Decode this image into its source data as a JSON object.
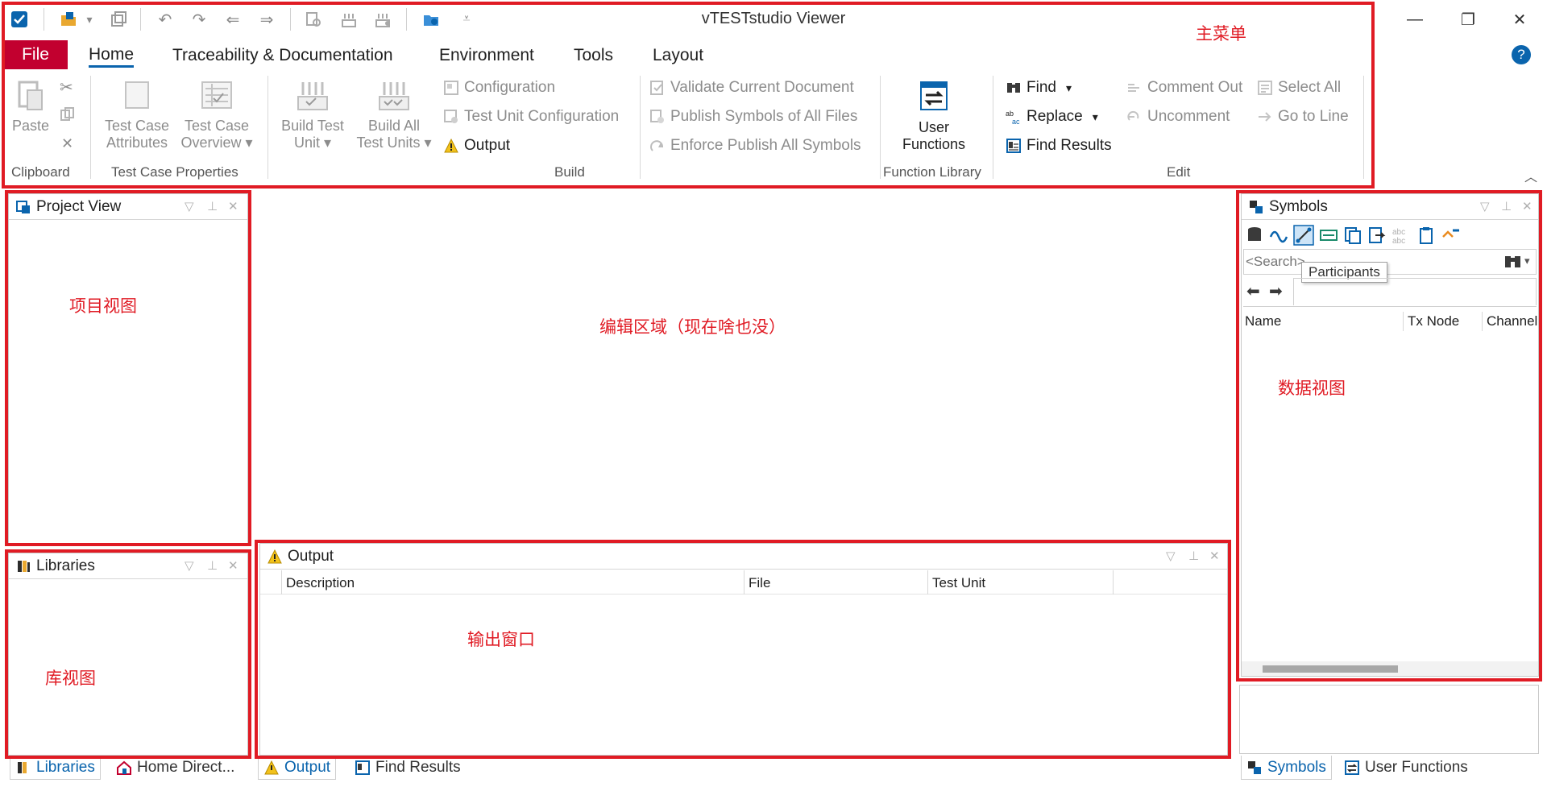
{
  "window": {
    "title": "vTESTstudio Viewer"
  },
  "menu": {
    "tabs": [
      "File",
      "Home",
      "Traceability & Documentation",
      "Environment",
      "Tools",
      "Layout"
    ]
  },
  "ribbon": {
    "clipboard": {
      "label": "Clipboard",
      "paste": "Paste"
    },
    "test_case_properties": {
      "label": "Test Case Properties",
      "attributes_line1": "Test Case",
      "attributes_line2": "Attributes",
      "overview_line1": "Test Case",
      "overview_line2": "Overview"
    },
    "build": {
      "label": "Build",
      "build_unit_line1": "Build Test",
      "build_unit_line2": "Unit",
      "build_all_line1": "Build All",
      "build_all_line2": "Test Units",
      "configuration": "Configuration",
      "test_unit_configuration": "Test Unit Configuration",
      "output": "Output",
      "validate": "Validate Current Document",
      "publish": "Publish Symbols of All Files",
      "enforce": "Enforce Publish All Symbols"
    },
    "function_library": {
      "label": "Function Library",
      "user_functions_line1": "User",
      "user_functions_line2": "Functions"
    },
    "edit": {
      "label": "Edit",
      "find": "Find",
      "replace": "Replace",
      "find_results": "Find Results",
      "comment_out": "Comment Out",
      "uncomment": "Uncomment",
      "select_all": "Select All",
      "go_to_line": "Go to Line"
    }
  },
  "panels": {
    "project_view": {
      "title": "Project View"
    },
    "libraries": {
      "title": "Libraries"
    },
    "output": {
      "title": "Output",
      "columns": [
        "Description",
        "File",
        "Test Unit"
      ]
    },
    "symbols": {
      "title": "Symbols",
      "search_placeholder": "<Search>",
      "tooltip": "Participants",
      "columns": [
        "Name",
        "Tx Node",
        "Channel"
      ]
    }
  },
  "bottom_tabs": {
    "left": [
      "Libraries",
      "Home Direct..."
    ],
    "center": [
      "Output",
      "Find Results"
    ],
    "right": [
      "Symbols",
      "User Functions"
    ]
  },
  "annotations": {
    "main_menu": "主菜单",
    "project_view": "项目视图",
    "edit_area": "编辑区域（现在啥也没）",
    "data_view": "数据视图",
    "library_view": "库视图",
    "output_window": "输出窗口"
  },
  "colors": {
    "file_tab": "#c2002f",
    "accent": "#0a64ad",
    "annotation_red": "#e01b24"
  }
}
